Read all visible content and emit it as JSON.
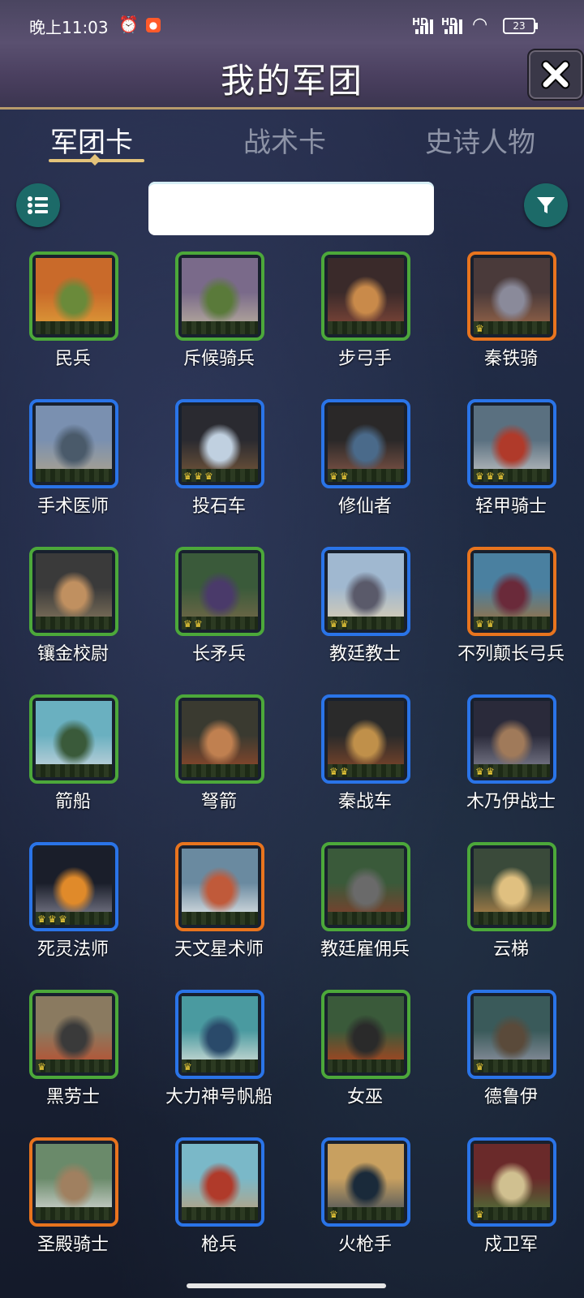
{
  "status_bar": {
    "time": "晚上11:03",
    "signal_1": "HD",
    "signal_2": "HD",
    "battery": "23",
    "icons": [
      "alarm-icon",
      "app-notification-icon",
      "signal-icon",
      "wifi-icon",
      "battery-icon"
    ]
  },
  "header": {
    "title": "我的军团",
    "close_icon": "close-icon"
  },
  "tabs": [
    {
      "label": "军团卡",
      "active": true
    },
    {
      "label": "战术卡",
      "active": false
    },
    {
      "label": "史诗人物",
      "active": false
    }
  ],
  "toolbar": {
    "list_icon": "list-icon",
    "filter_icon": "filter-icon",
    "search_value": "",
    "search_placeholder": ""
  },
  "colors": {
    "green": "#4ca83a",
    "blue": "#2a74e8",
    "orange": "#e8741e",
    "accent_gold": "#e4c37a",
    "round_button": "#1c6a68"
  },
  "cards": [
    {
      "name": "民兵",
      "rarity": "green",
      "crowns": 0
    },
    {
      "name": "斥候骑兵",
      "rarity": "green",
      "crowns": 0
    },
    {
      "name": "步弓手",
      "rarity": "green",
      "crowns": 0
    },
    {
      "name": "秦铁骑",
      "rarity": "orange",
      "crowns": 1
    },
    {
      "name": "手术医师",
      "rarity": "blue",
      "crowns": 0
    },
    {
      "name": "投石车",
      "rarity": "blue",
      "crowns": 3
    },
    {
      "name": "修仙者",
      "rarity": "blue",
      "crowns": 2
    },
    {
      "name": "轻甲骑士",
      "rarity": "blue",
      "crowns": 3
    },
    {
      "name": "镶金校尉",
      "rarity": "green",
      "crowns": 0
    },
    {
      "name": "长矛兵",
      "rarity": "green",
      "crowns": 2
    },
    {
      "name": "教廷教士",
      "rarity": "blue",
      "crowns": 2
    },
    {
      "name": "不列颠长弓兵",
      "rarity": "orange",
      "crowns": 2
    },
    {
      "name": "箭船",
      "rarity": "green",
      "crowns": 0
    },
    {
      "name": "弩箭",
      "rarity": "green",
      "crowns": 0
    },
    {
      "name": "秦战车",
      "rarity": "blue",
      "crowns": 2
    },
    {
      "name": "木乃伊战士",
      "rarity": "blue",
      "crowns": 2
    },
    {
      "name": "死灵法师",
      "rarity": "blue",
      "crowns": 3
    },
    {
      "name": "天文星术师",
      "rarity": "orange",
      "crowns": 0
    },
    {
      "name": "教廷雇佣兵",
      "rarity": "green",
      "crowns": 0
    },
    {
      "name": "云梯",
      "rarity": "green",
      "crowns": 0
    },
    {
      "name": "黑劳士",
      "rarity": "green",
      "crowns": 1
    },
    {
      "name": "大力神号帆船",
      "rarity": "blue",
      "crowns": 1
    },
    {
      "name": "女巫",
      "rarity": "green",
      "crowns": 0
    },
    {
      "name": "德鲁伊",
      "rarity": "blue",
      "crowns": 1
    },
    {
      "name": "圣殿骑士",
      "rarity": "orange",
      "crowns": 0
    },
    {
      "name": "枪兵",
      "rarity": "blue",
      "crowns": 0
    },
    {
      "name": "火枪手",
      "rarity": "blue",
      "crowns": 1
    },
    {
      "name": "戍卫军",
      "rarity": "blue",
      "crowns": 1
    }
  ]
}
